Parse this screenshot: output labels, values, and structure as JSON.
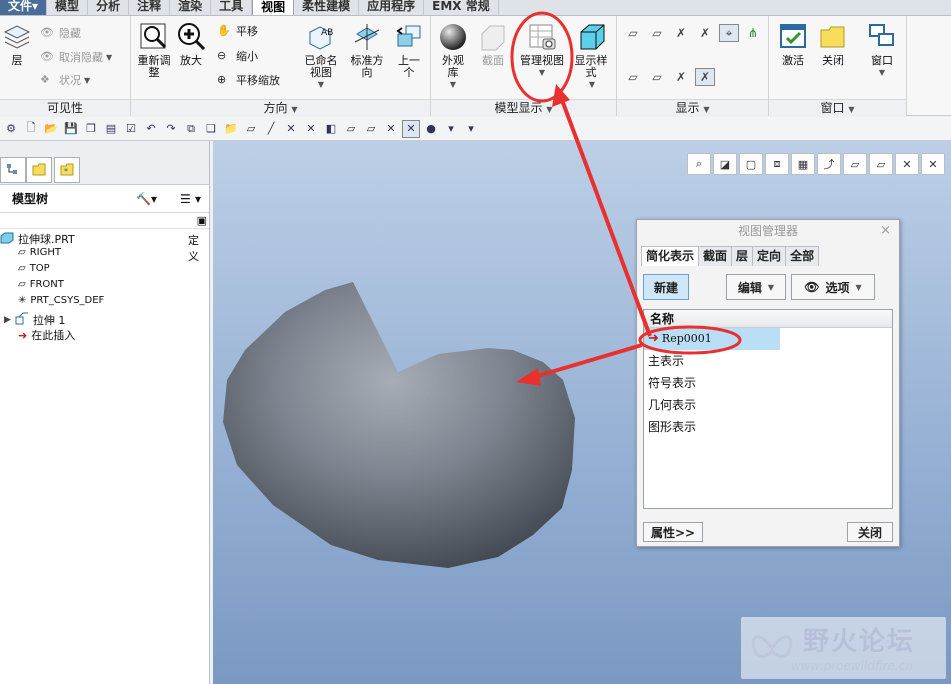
{
  "menu": {
    "tabs": [
      "文件",
      "模型",
      "分析",
      "注释",
      "渲染",
      "工具",
      "视图",
      "柔性建模",
      "应用程序",
      "EMX 常规"
    ],
    "file_arrow": "▾"
  },
  "ribbon": {
    "visibility": {
      "layer": "层",
      "hide": "隐藏",
      "unhide": "取消隐藏",
      "status": "状况",
      "group_label": "可见性"
    },
    "orientation": {
      "refit": "重新调整",
      "zoom_in": "放大",
      "pan": "平移",
      "zoom_out": "缩小",
      "pan_zoom": "平移缩放",
      "saved_views": "已命名视图",
      "standard_orientation": "标准方向",
      "previous": "上一个",
      "group_label": "方向"
    },
    "model_display": {
      "appearance_gallery": "外观库",
      "section": "截面",
      "manage_views": "管理视图",
      "display_style": "显示样式",
      "group_label": "模型显示"
    },
    "show": {
      "group_label": "显示"
    },
    "window": {
      "activate": "激活",
      "close": "关闭",
      "windows": "窗口",
      "group_label": "窗口"
    }
  },
  "model_tree": {
    "title": "模型树",
    "column_hint": "定义",
    "items": [
      {
        "label": "拉伸球.PRT",
        "icon": "part-icon"
      },
      {
        "label": "RIGHT",
        "icon": "datum-plane-icon"
      },
      {
        "label": "TOP",
        "icon": "datum-plane-icon"
      },
      {
        "label": "FRONT",
        "icon": "datum-plane-icon"
      },
      {
        "label": "PRT_CSYS_DEF",
        "icon": "csys-icon"
      },
      {
        "label": "拉伸 1",
        "icon": "extrude-icon"
      },
      {
        "label": "在此插入",
        "icon": "insert-here-icon"
      }
    ]
  },
  "view_manager": {
    "title": "视图管理器",
    "close_glyph": "×",
    "tabs": [
      "简化表示",
      "截面",
      "层",
      "定向",
      "全部"
    ],
    "new_button": "新建",
    "edit_button": "编辑",
    "options_button": "选项",
    "list_header": "名称",
    "rows": [
      "Rep0001",
      "主表示",
      "符号表示",
      "几何表示",
      "图形表示"
    ],
    "properties_button": "属性>>",
    "close_button": "关闭"
  },
  "watermark": {
    "title": "野火论坛",
    "url": "www.proewildfire.cn"
  },
  "colors": {
    "annotation_red": "#e8312f",
    "file_tab": "#4a6c98",
    "selected_row": "#b9def5",
    "viewport_top": "#bccfe6",
    "viewport_bottom": "#7a98c2"
  }
}
